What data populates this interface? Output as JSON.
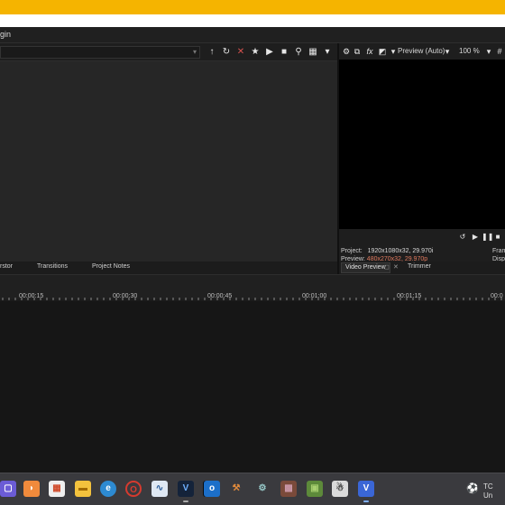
{
  "menubar": {
    "item": "gin"
  },
  "explorer": {
    "path": ""
  },
  "preview": {
    "mode_label": "Preview (Auto)",
    "zoom": "100 %",
    "project_label": "Project:",
    "project_value": "1920x1080x32, 29.970i",
    "preview_label": "Preview:",
    "preview_value": "480x270x32, 29.970p",
    "frame_label": "Fram",
    "display_label": "Displ"
  },
  "tabs": {
    "left": [
      "rstor",
      "Transitions",
      "Project Notes"
    ],
    "video_preview": "Video Preview",
    "trimmer": "Trimmer"
  },
  "ruler": [
    "00:00:15",
    "00:00:30",
    "00:00:45",
    "00:01:00",
    "00:01:15",
    "00:0"
  ],
  "tray": {
    "text": "TC",
    "sub": "Un"
  }
}
